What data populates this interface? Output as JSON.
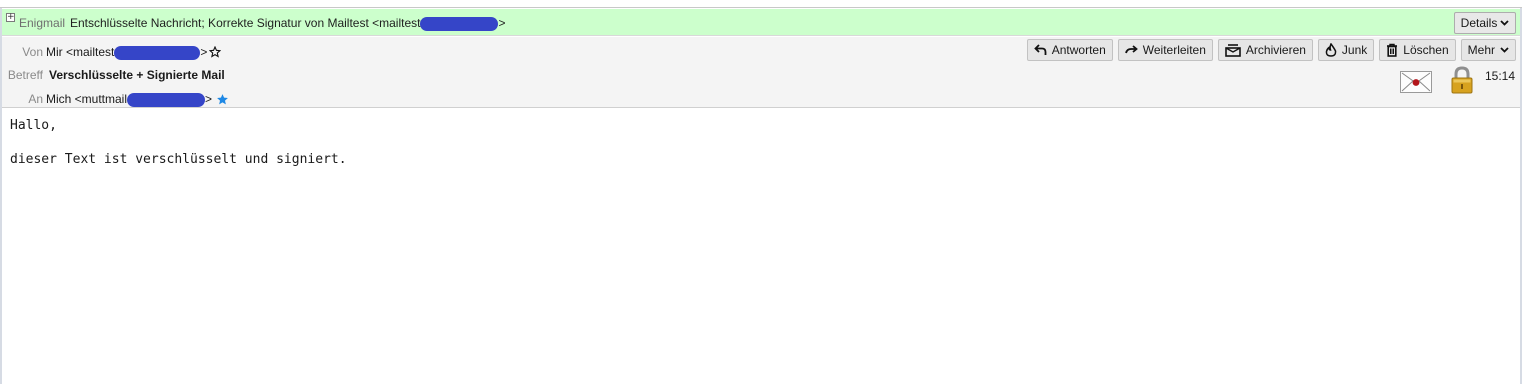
{
  "enigmail": {
    "label": "Enigmail",
    "message_prefix": "Entschlüsselte Nachricht; Korrekte Signatur von Mailtest <mailtest",
    "message_suffix": ">",
    "details_label": "Details"
  },
  "headers": {
    "from_label": "Von",
    "from_value": "Mir <mailtest",
    "from_suffix": ">",
    "subject_label": "Betreff",
    "subject_value": "Verschlüsselte + Signierte Mail",
    "to_label": "An",
    "to_value": "Mich <muttmail",
    "to_suffix": ">",
    "time": "15:14"
  },
  "toolbar": {
    "reply": "Antworten",
    "forward": "Weiterleiten",
    "archive": "Archivieren",
    "junk": "Junk",
    "delete": "Löschen",
    "more": "Mehr"
  },
  "body": {
    "line1": "Hallo,",
    "line2": "dieser Text ist verschlüsselt und signiert."
  },
  "colors": {
    "enigmail_bar": "#ccffcc",
    "redaction": "#3545c8",
    "star_active": "#1e88e5"
  }
}
